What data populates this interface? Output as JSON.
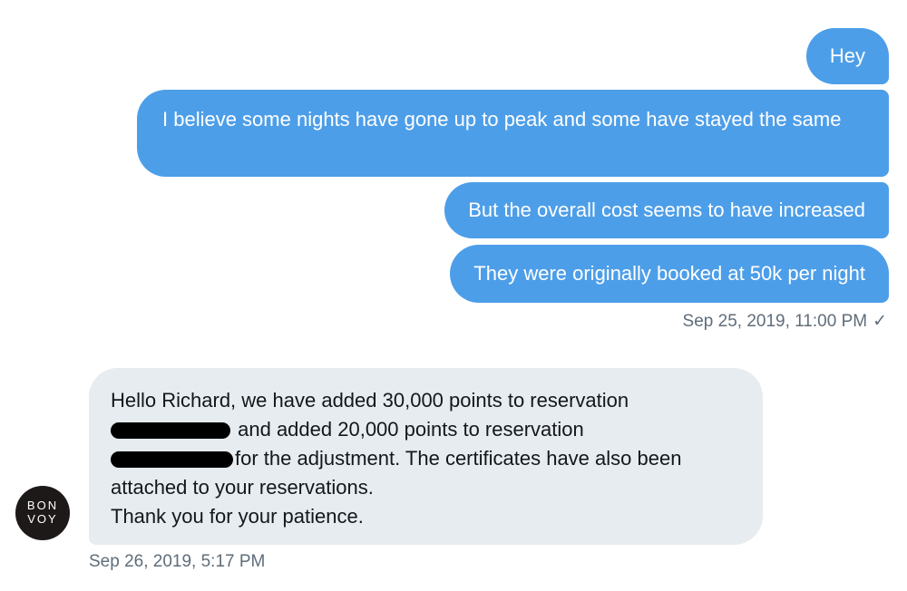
{
  "outgoing": {
    "messages": [
      "Hey",
      "I believe some nights have gone up to peak and some have stayed the same",
      "But the overall cost seems to have increased",
      "They were originally booked at 50k per night"
    ],
    "timestamp": "Sep 25, 2019, 11:00 PM",
    "status_icon": "✓",
    "bubble_color": "#4d9ee8"
  },
  "incoming": {
    "lines": {
      "l1": "Hello Richard, we have added 30,000 points to reservation",
      "l2": "and added 20,000 points to reservation",
      "l3": "for the adjustment. The certificates have also been",
      "l4": "attached to your reservations.",
      "l5": "Thank you for your patience."
    },
    "timestamp": "Sep 26, 2019, 5:17 PM",
    "bubble_color": "#e6ecf0"
  },
  "avatar": {
    "top": "BON",
    "bottom": "VOY"
  }
}
